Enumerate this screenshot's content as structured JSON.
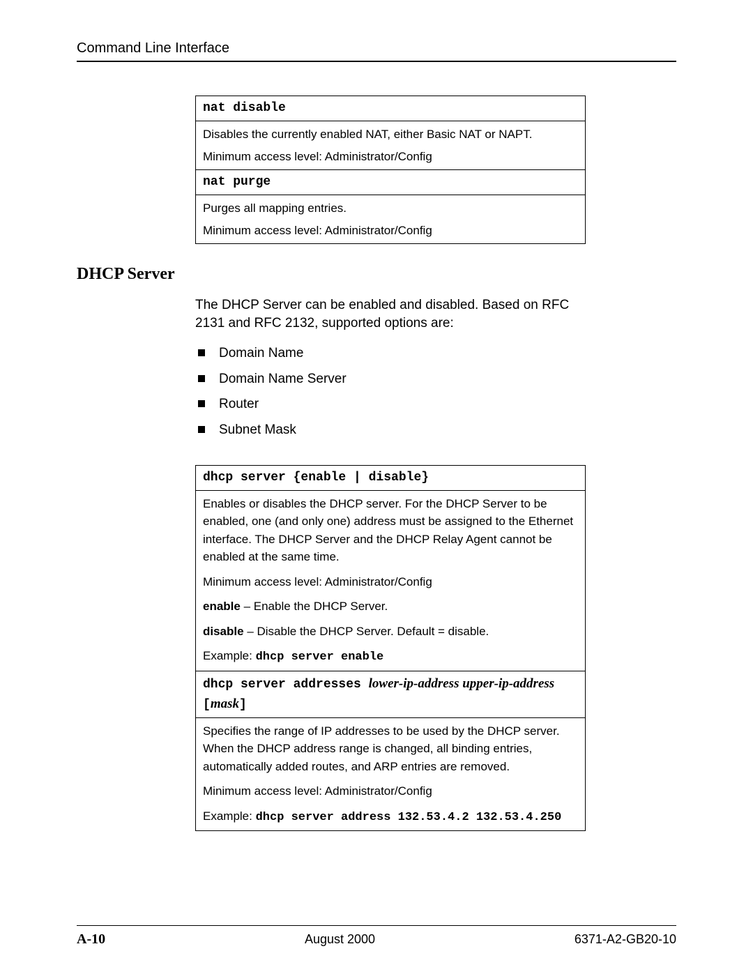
{
  "header": {
    "title": "Command Line Interface"
  },
  "table1": {
    "row1": {
      "cmd": "nat disable",
      "line1": "Disables the currently enabled NAT, either Basic NAT or NAPT.",
      "line2": "Minimum access level: Administrator/Config"
    },
    "row2": {
      "cmd": "nat purge",
      "line1": "Purges all mapping entries.",
      "line2": "Minimum access level: Administrator/Config"
    }
  },
  "section": {
    "title": "DHCP Server",
    "intro": "The DHCP Server can be enabled and disabled. Based on RFC 2131 and RFC 2132, supported options are:",
    "bullets": [
      "Domain Name",
      "Domain Name Server",
      "Router",
      "Subnet Mask"
    ]
  },
  "table2": {
    "row1": {
      "cmd": "dhcp server {enable | disable}",
      "desc": "Enables or disables the DHCP server. For the DHCP Server to be enabled, one (and only one) address must be assigned to the Ethernet interface. The DHCP Server and the DHCP Relay Agent cannot be enabled at the same time.",
      "min": "Minimum access level: Administrator/Config",
      "enable_label": "enable",
      "enable_desc": " – Enable the DHCP Server.",
      "disable_label": "disable",
      "disable_desc": " – Disable the DHCP Server. Default = disable.",
      "example_label": "Example: ",
      "example_code": "dhcp server enable"
    },
    "row2": {
      "cmd_prefix": "dhcp server addresses ",
      "cmd_args": "lower-ip-address  upper-ip-address ",
      "cmd_opt_open": "[",
      "cmd_opt_arg": "mask",
      "cmd_opt_close": "]",
      "desc": "Specifies the range of IP addresses to be used by the DHCP server. When the DHCP address range is changed, all binding entries, automatically added routes, and ARP entries are removed.",
      "min": "Minimum access level: Administrator/Config",
      "example_label": "Example: ",
      "example_code": "dhcp server address 132.53.4.2 132.53.4.250"
    }
  },
  "footer": {
    "page": "A-10",
    "date": "August 2000",
    "doc": "6371-A2-GB20-10"
  }
}
